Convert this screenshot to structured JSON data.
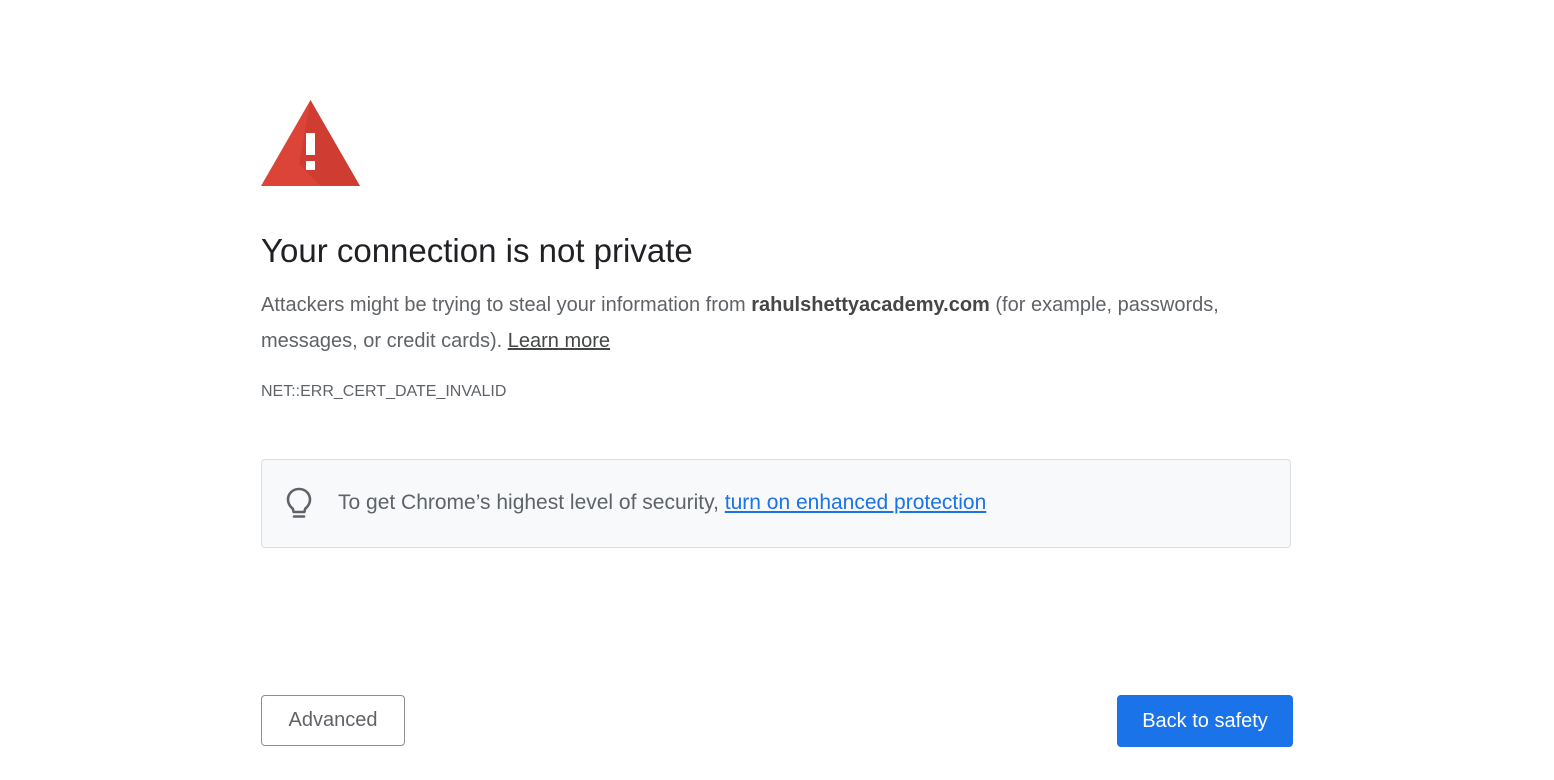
{
  "icons": {
    "warning": "warning-triangle-icon",
    "tip": "lightbulb-icon"
  },
  "colors": {
    "warning_red": "#d93025",
    "primary_blue": "#1a73e8",
    "text_gray": "#5f6368"
  },
  "heading": "Your connection is not private",
  "description": {
    "before": "Attackers might be trying to steal your information from ",
    "domain": "rahulshettyacademy.com",
    "after": " (for example, passwords, messages, or credit cards). ",
    "learn_more": "Learn more"
  },
  "error_code": "NET::ERR_CERT_DATE_INVALID",
  "tip": {
    "text": "To get Chrome’s highest level of security, ",
    "link": "turn on enhanced protection"
  },
  "buttons": {
    "advanced": "Advanced",
    "back_to_safety": "Back to safety"
  }
}
